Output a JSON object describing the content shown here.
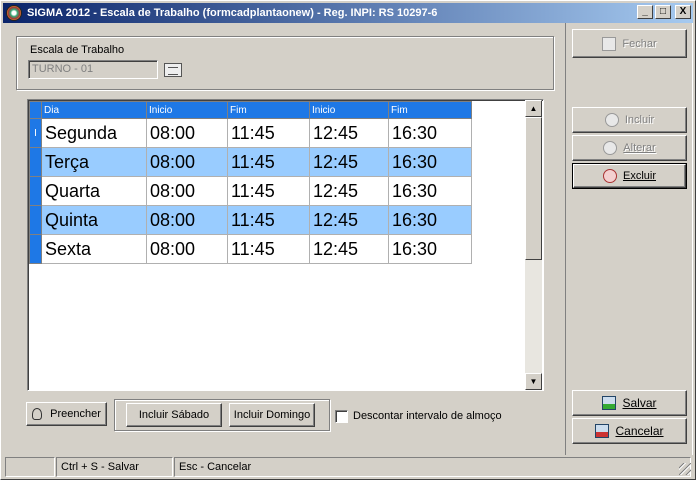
{
  "window": {
    "title": "SIGMA 2012 - Escala de Trabalho  (formcadplantaonew)  - Reg. INPI: RS 10297-6",
    "controls": {
      "minimize": "_",
      "maximize": "□",
      "close": "X"
    }
  },
  "form": {
    "escala_label": "Escala de Trabalho",
    "escala_value": "TURNO - 01"
  },
  "grid": {
    "columns": [
      "Dia",
      "Inicio",
      "Fim",
      "Inicio",
      "Fim"
    ],
    "rows": [
      {
        "dia": "Segunda",
        "inicio1": "08:00",
        "fim1": "11:45",
        "inicio2": "12:45",
        "fim2": "16:30",
        "current": true
      },
      {
        "dia": "Terça",
        "inicio1": "08:00",
        "fim1": "11:45",
        "inicio2": "12:45",
        "fim2": "16:30"
      },
      {
        "dia": "Quarta",
        "inicio1": "08:00",
        "fim1": "11:45",
        "inicio2": "12:45",
        "fim2": "16:30"
      },
      {
        "dia": "Quinta",
        "inicio1": "08:00",
        "fim1": "11:45",
        "inicio2": "12:45",
        "fim2": "16:30"
      },
      {
        "dia": "Sexta",
        "inicio1": "08:00",
        "fim1": "11:45",
        "inicio2": "12:45",
        "fim2": "16:30"
      }
    ],
    "row_indicator": "I",
    "row_colors": {
      "normal": "#ffffff",
      "alternate": "#99ccff",
      "header": "#1e78e6"
    }
  },
  "bottom": {
    "preencher": "Preencher",
    "incluir_sabado": "Incluir Sábado",
    "incluir_domingo": "Incluir Domingo",
    "descontar_label": "Descontar intervalo de almoço",
    "descontar_checked": false
  },
  "side": {
    "fechar": "Fechar",
    "incluir": "Incluir",
    "alterar": "Alterar",
    "excluir": "Excluir",
    "salvar": "Salvar",
    "cancelar": "Cancelar"
  },
  "status": {
    "panel1": "",
    "panel2": "Ctrl + S - Salvar",
    "panel3": "Esc - Cancelar"
  }
}
